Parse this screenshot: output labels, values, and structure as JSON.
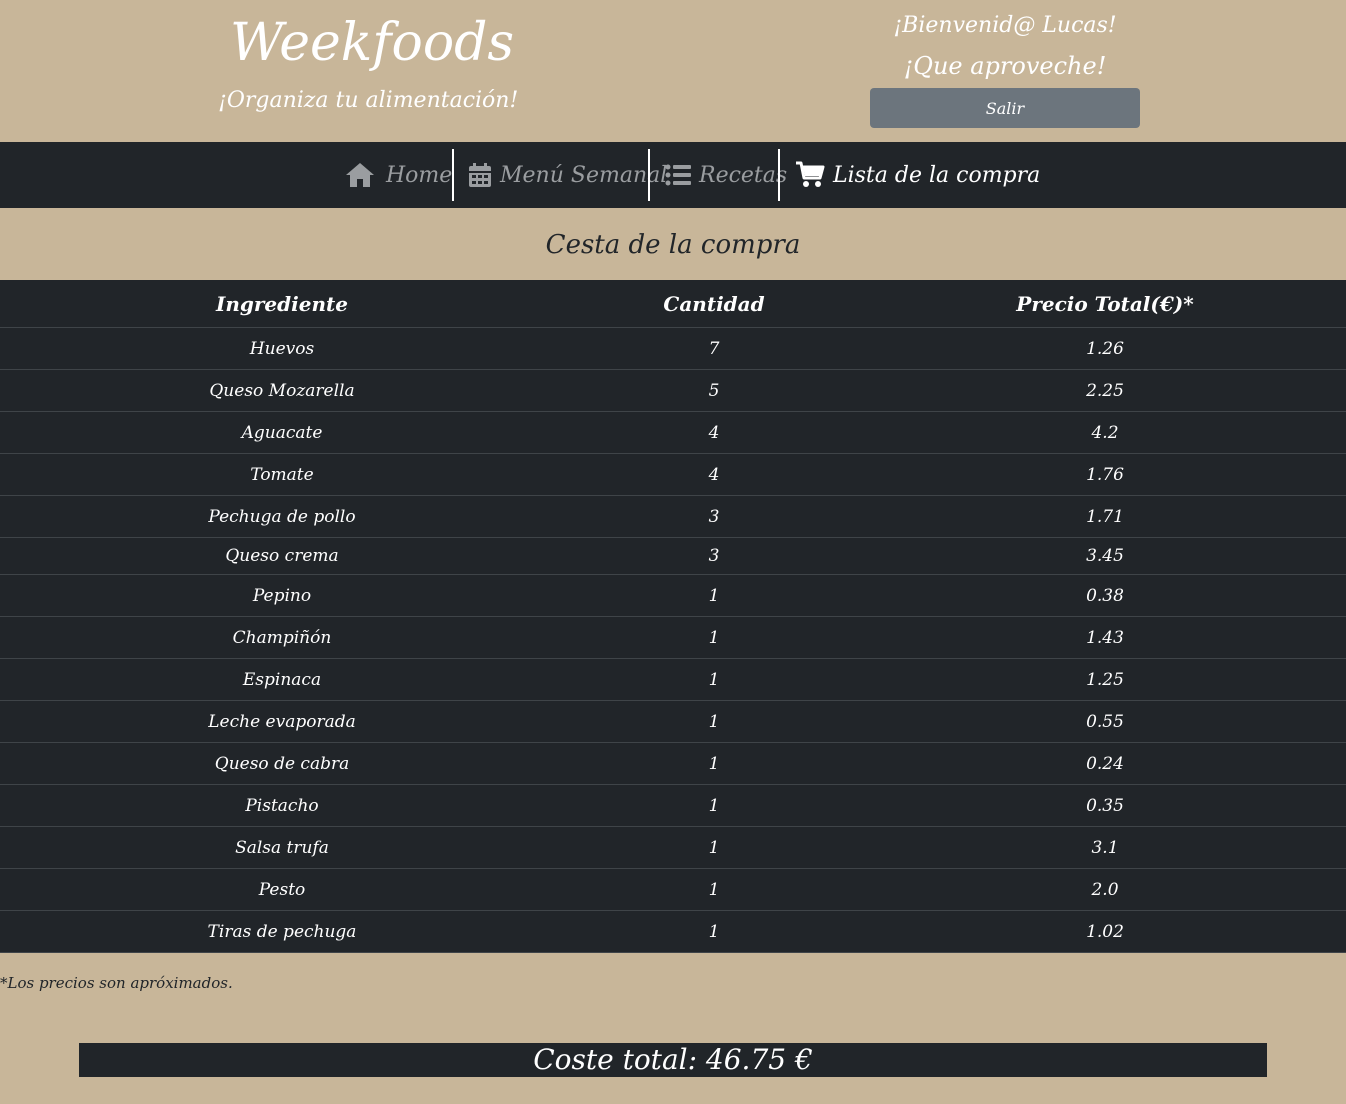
{
  "header": {
    "brand_title": "Weekfoods",
    "brand_subtitle": "¡Organiza tu alimentación!",
    "welcome_line1": "¡Bienvenid@ Lucas!",
    "welcome_line2": "¡Que aproveche!",
    "logout_label": "Salir"
  },
  "nav": {
    "items": [
      {
        "label": "Home",
        "icon": "home-icon",
        "active": false
      },
      {
        "label": "Menú Semanal",
        "icon": "calendar-icon",
        "active": false
      },
      {
        "label": "Recetas",
        "icon": "list-icon",
        "active": false
      },
      {
        "label": "Lista de la compra",
        "icon": "cart-icon",
        "active": true
      }
    ]
  },
  "main": {
    "title": "Cesta de la compra",
    "columns": [
      "Ingrediente",
      "Cantidad",
      "Precio Total(€)*"
    ],
    "rows": [
      {
        "ingredient": "Huevos",
        "qty": "7",
        "price": "1.26"
      },
      {
        "ingredient": "Queso Mozarella",
        "qty": "5",
        "price": "2.25"
      },
      {
        "ingredient": "Aguacate",
        "qty": "4",
        "price": "4.2"
      },
      {
        "ingredient": "Tomate",
        "qty": "4",
        "price": "1.76"
      },
      {
        "ingredient": "Pechuga de pollo",
        "qty": "3",
        "price": "1.71"
      },
      {
        "ingredient": "Queso crema",
        "qty": "3",
        "price": "3.45"
      },
      {
        "ingredient": "Pepino",
        "qty": "1",
        "price": "0.38"
      },
      {
        "ingredient": "Champiñón",
        "qty": "1",
        "price": "1.43"
      },
      {
        "ingredient": "Espinaca",
        "qty": "1",
        "price": "1.25"
      },
      {
        "ingredient": "Leche evaporada",
        "qty": "1",
        "price": "0.55"
      },
      {
        "ingredient": "Queso de cabra",
        "qty": "1",
        "price": "0.24"
      },
      {
        "ingredient": "Pistacho",
        "qty": "1",
        "price": "0.35"
      },
      {
        "ingredient": "Salsa trufa",
        "qty": "1",
        "price": "3.1"
      },
      {
        "ingredient": "Pesto",
        "qty": "1",
        "price": "2.0"
      },
      {
        "ingredient": "Tiras de pechuga",
        "qty": "1",
        "price": "1.02"
      }
    ],
    "footnote": "*Los precios son apróximados.",
    "total": "Coste total: 46.75 €"
  },
  "colors": {
    "background": "#c8b699",
    "dark": "#212529",
    "button_gray": "#6c757d",
    "nav_inactive": "#9a9da0"
  }
}
